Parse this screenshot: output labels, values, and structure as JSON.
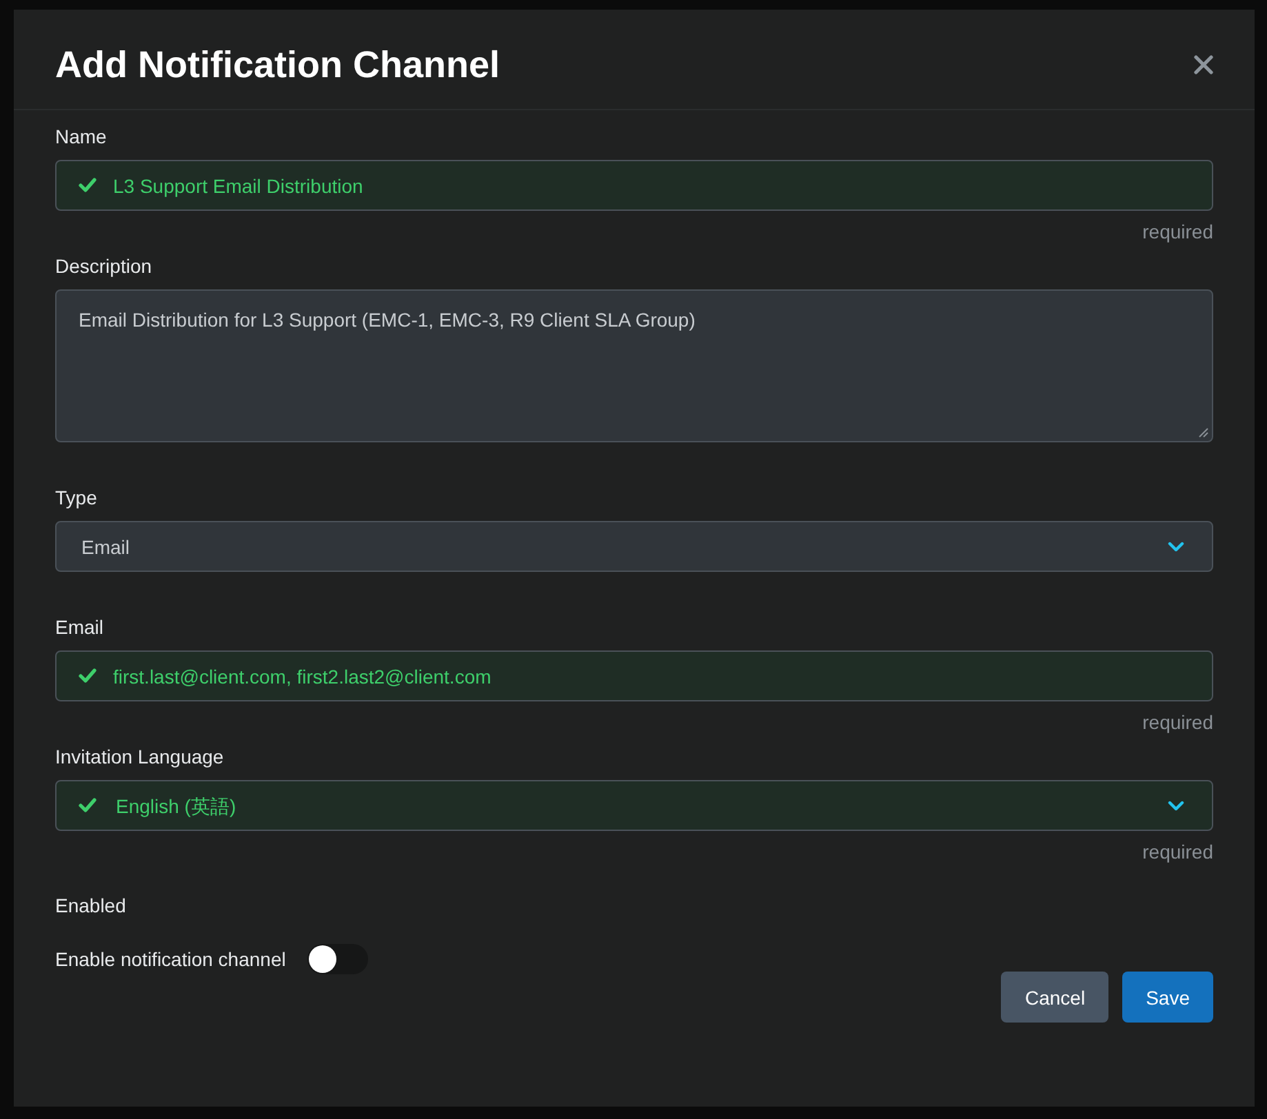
{
  "dialog": {
    "title": "Add Notification Channel"
  },
  "fields": [
    {
      "kind": "text",
      "label": "Name",
      "value": "L3 Support Email Distribution",
      "valid": true,
      "hint": "required"
    },
    {
      "kind": "textarea",
      "label": "Description",
      "value": "Email Distribution for L3 Support (EMC-1, EMC-3, R9 Client SLA Group)",
      "valid": false
    },
    {
      "kind": "select",
      "label": "Type",
      "value": "Email",
      "valid": false
    },
    {
      "kind": "text",
      "label": "Email",
      "value": "first.last@client.com, first2.last2@client.com",
      "valid": true,
      "hint": "required"
    },
    {
      "kind": "select",
      "label": "Invitation Language",
      "value": "English (英語)",
      "valid": true,
      "hint": "required"
    }
  ],
  "enabled": {
    "label": "Enabled",
    "toggle_label": "Enable notification channel",
    "on": false
  },
  "buttons": [
    {
      "label": "Cancel",
      "kind": "secondary"
    },
    {
      "label": "Save",
      "kind": "primary"
    }
  ]
}
